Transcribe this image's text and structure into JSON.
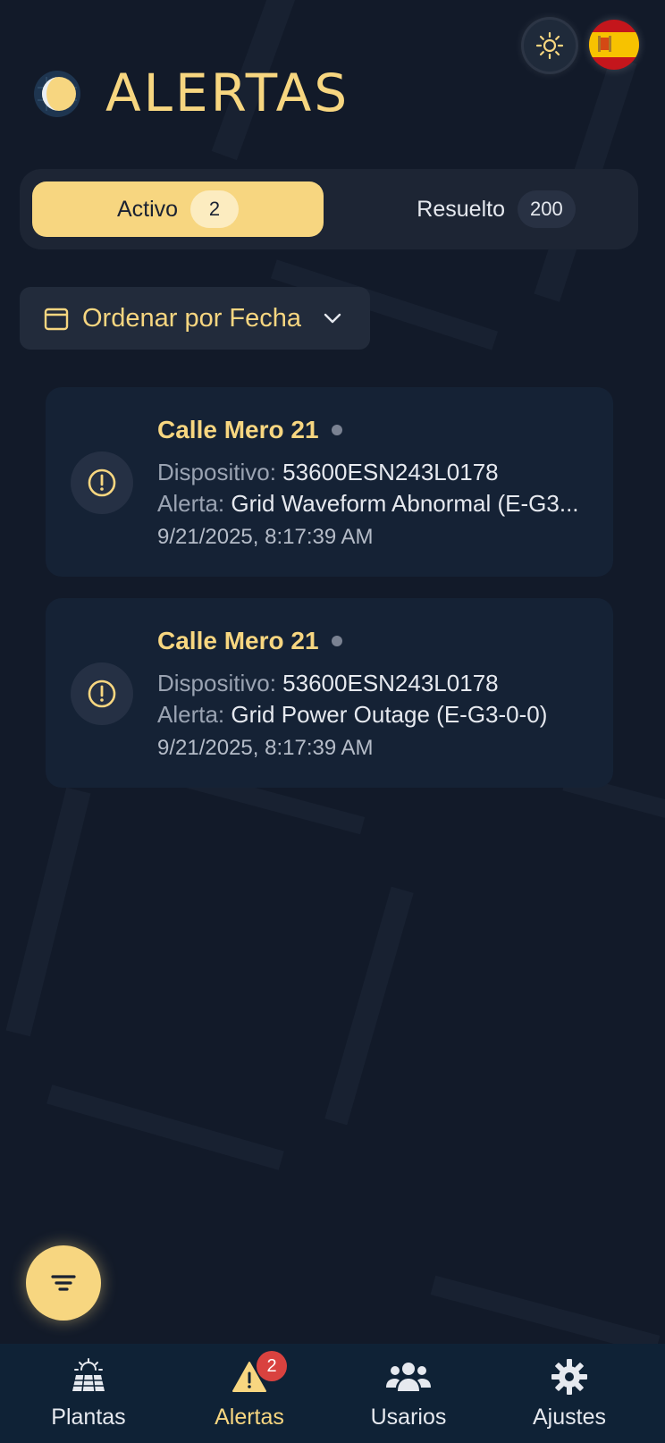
{
  "header": {
    "title": "ALERTAS"
  },
  "tabs": {
    "active": {
      "label": "Activo",
      "count": "2"
    },
    "resolved": {
      "label": "Resuelto",
      "count": "200"
    }
  },
  "sort": {
    "label": "Ordenar por Fecha"
  },
  "alerts": [
    {
      "plant": "Calle Mero 21",
      "device_label": "Dispositivo:",
      "device": "53600ESN243L0178",
      "alert_label": "Alerta:",
      "alert": "Grid Waveform Abnormal (E-G3...",
      "date": "9/21/2025, 8:17:39 AM"
    },
    {
      "plant": "Calle Mero 21",
      "device_label": "Dispositivo:",
      "device": "53600ESN243L0178",
      "alert_label": "Alerta:",
      "alert": "Grid Power Outage (E-G3-0-0)",
      "date": "9/21/2025, 8:17:39 AM"
    }
  ],
  "nav": {
    "items": [
      {
        "label": "Plantas",
        "icon": "solar-panel-icon"
      },
      {
        "label": "Alertas",
        "icon": "warning-icon",
        "badge": "2"
      },
      {
        "label": "Usarios",
        "icon": "users-icon"
      },
      {
        "label": "Ajustes",
        "icon": "gear-icon"
      }
    ]
  },
  "colors": {
    "accent": "#f7d680",
    "background": "#121a29",
    "badge": "#d9423f"
  }
}
